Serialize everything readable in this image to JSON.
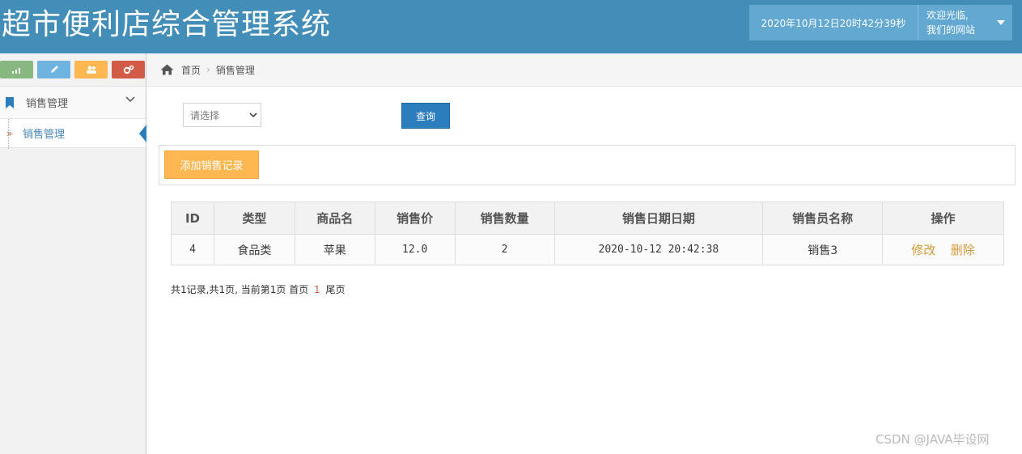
{
  "app_title": "超市便利店综合管理系统",
  "header": {
    "datetime": "2020年10月12日20时42分39秒",
    "welcome_line1": "欢迎光临,",
    "welcome_line2": "我们的网站"
  },
  "shortcuts": [
    {
      "icon": "signal-icon",
      "color": "#87b87f"
    },
    {
      "icon": "pencil-icon",
      "color": "#6fb3e0"
    },
    {
      "icon": "users-icon",
      "color": "#ffb752"
    },
    {
      "icon": "cogs-icon",
      "color": "#d15b47"
    }
  ],
  "sidebar": {
    "menu_label": "销售管理",
    "sub_label": "销售管理",
    "sub_arrow": "»"
  },
  "breadcrumb": {
    "home": "首页",
    "sep": "›",
    "current": "销售管理"
  },
  "search": {
    "select_value": "请选择",
    "query_label": "查询"
  },
  "add_label": "添加销售记录",
  "table": {
    "headers": [
      "ID",
      "类型",
      "商品名",
      "销售价",
      "销售数量",
      "销售日期日期",
      "销售员名称",
      "操作"
    ],
    "rows": [
      {
        "id": "4",
        "type": "食品类",
        "name": "苹果",
        "price": "12.0",
        "qty": "2",
        "date": "2020-10-12 20:42:38",
        "seller": "销售3",
        "edit": "修改",
        "delete": "删除"
      }
    ]
  },
  "pager": {
    "prefix": "共1记录,共1页, 当前第1页",
    "first": "首页",
    "current": "1",
    "last": "尾页"
  },
  "watermark": "CSDN @JAVA毕设网",
  "colors": {
    "header_bg": "#438eb9",
    "primary": "#2b7dbc",
    "warning": "#ffb752",
    "danger": "#d15b47",
    "link": "#d49a3a"
  }
}
